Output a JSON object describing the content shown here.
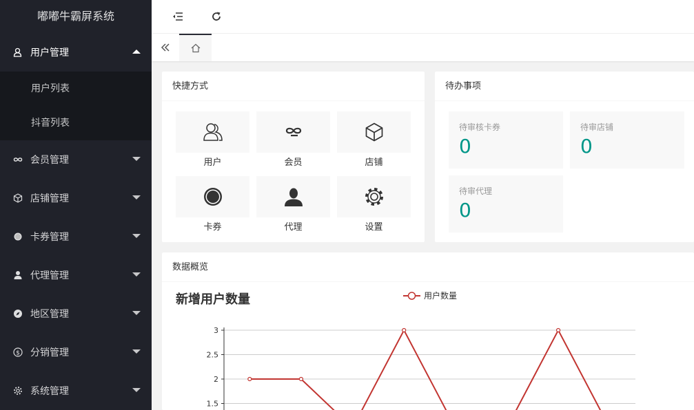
{
  "app": {
    "title": "嘟嘟牛霸屏系统"
  },
  "sidebar": {
    "groups": [
      {
        "label": "用户管理",
        "icon": "user-icon",
        "open": true,
        "children": [
          {
            "label": "用户列表"
          },
          {
            "label": "抖音列表"
          }
        ]
      },
      {
        "label": "会员管理",
        "icon": "infinity-icon"
      },
      {
        "label": "店铺管理",
        "icon": "cube-icon"
      },
      {
        "label": "卡券管理",
        "icon": "circle-icon"
      },
      {
        "label": "代理管理",
        "icon": "person-icon"
      },
      {
        "label": "地区管理",
        "icon": "compass-icon"
      },
      {
        "label": "分销管理",
        "icon": "dollar-icon"
      },
      {
        "label": "系统管理",
        "icon": "gear-icon"
      }
    ]
  },
  "header": {
    "collapse_icon": "menu-fold-icon",
    "refresh_icon": "refresh-icon"
  },
  "tabs": {
    "back_icon": "double-left-icon",
    "home_icon": "home-icon"
  },
  "quick": {
    "title": "快捷方式",
    "items": [
      {
        "label": "用户",
        "icon": "users-icon"
      },
      {
        "label": "会员",
        "icon": "infinity-icon"
      },
      {
        "label": "店铺",
        "icon": "cube-icon"
      },
      {
        "label": "卡券",
        "icon": "circle-icon"
      },
      {
        "label": "代理",
        "icon": "person-icon"
      },
      {
        "label": "设置",
        "icon": "gear-icon"
      }
    ]
  },
  "todo": {
    "title": "待办事项",
    "items": [
      {
        "label": "待审核卡券",
        "value": "0"
      },
      {
        "label": "待审店铺",
        "value": "0"
      },
      {
        "label": "待审代理",
        "value": "0"
      }
    ]
  },
  "overview": {
    "title": "数据概览"
  },
  "colors": {
    "accent": "#009688",
    "series": "#c23531",
    "sidebar_bg": "#20222a"
  },
  "chart_data": {
    "type": "line",
    "title": "新增用户数量",
    "series": [
      {
        "name": "用户数量",
        "values": [
          2,
          2,
          1,
          3,
          1,
          1,
          3,
          1
        ]
      }
    ],
    "y_ticks": [
      "3",
      "2.5",
      "2",
      "1.5"
    ],
    "ylim": [
      1,
      3
    ],
    "grid": true,
    "legend": "top-center"
  }
}
